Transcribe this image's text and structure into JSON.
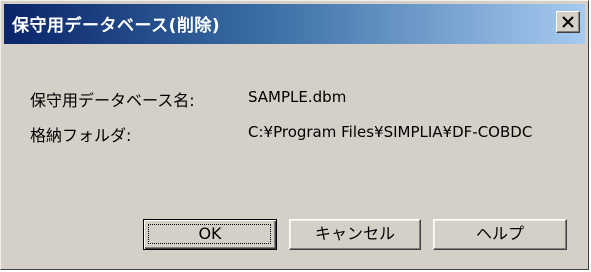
{
  "window": {
    "title": "保守用データベース(削除)"
  },
  "fields": {
    "db_name": {
      "label": "保守用データベース名:",
      "value": "SAMPLE.dbm"
    },
    "folder": {
      "label": "格納フォルダ:",
      "value": "C:¥Program Files¥SIMPLIA¥DF-COBDC"
    }
  },
  "buttons": {
    "ok": "OK",
    "cancel": "キャンセル",
    "help": "ヘルプ"
  },
  "icons": {
    "close": "close-icon"
  }
}
